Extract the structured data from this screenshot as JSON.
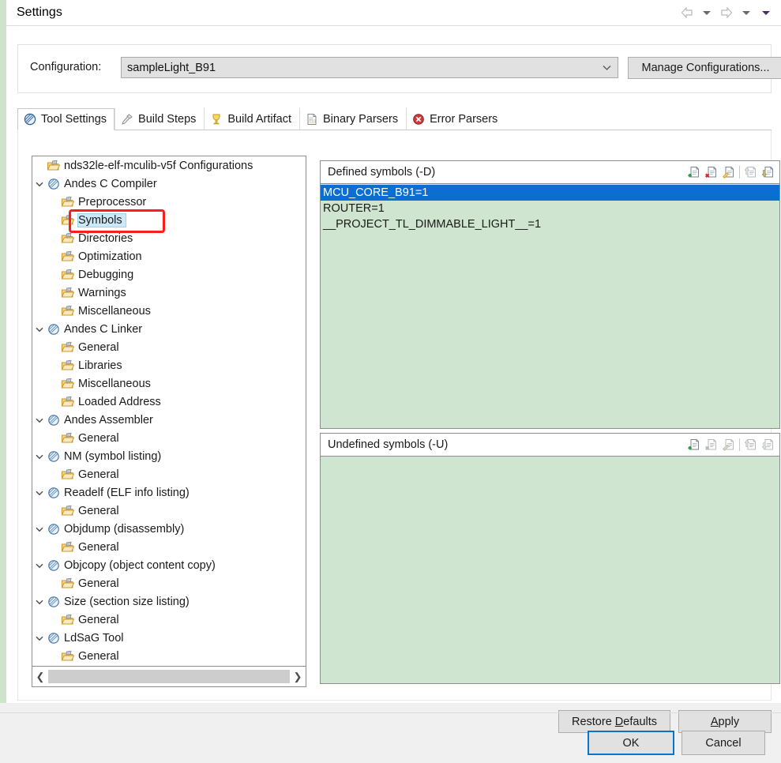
{
  "window": {
    "title": "Settings",
    "nav": {
      "back_icon": "arrow-left-icon",
      "back_dropdown_icon": "chevron-down-icon",
      "forward_icon": "arrow-right-icon",
      "forward_dropdown_icon": "chevron-down-icon",
      "menu_dropdown_icon": "chevron-down-icon"
    }
  },
  "configuration": {
    "label": "Configuration:",
    "value": "sampleLight_B91",
    "dropdown_icon": "chevron-down-icon",
    "manage_button": "Manage Configurations..."
  },
  "tabs": [
    {
      "label": "Tool Settings",
      "icon": "tool-settings-icon",
      "active": true
    },
    {
      "label": "Build Steps",
      "icon": "build-steps-icon",
      "active": false
    },
    {
      "label": "Build Artifact",
      "icon": "build-artifact-icon",
      "active": false
    },
    {
      "label": "Binary Parsers",
      "icon": "binary-parsers-icon",
      "active": false
    },
    {
      "label": "Error Parsers",
      "icon": "error-parsers-icon",
      "active": false
    }
  ],
  "tree": {
    "items": [
      {
        "label": "nds32le-elf-mculib-v5f Configurations",
        "indent": 0,
        "icon": "folder-icon",
        "twisty": "none",
        "selected": false
      },
      {
        "label": "Andes C Compiler",
        "indent": 0,
        "icon": "tool-icon",
        "twisty": "expanded",
        "selected": false
      },
      {
        "label": "Preprocessor",
        "indent": 1,
        "icon": "folder-icon",
        "twisty": "none",
        "selected": false
      },
      {
        "label": "Symbols",
        "indent": 1,
        "icon": "folder-icon",
        "twisty": "none",
        "selected": true
      },
      {
        "label": "Directories",
        "indent": 1,
        "icon": "folder-icon",
        "twisty": "none",
        "selected": false
      },
      {
        "label": "Optimization",
        "indent": 1,
        "icon": "folder-icon",
        "twisty": "none",
        "selected": false
      },
      {
        "label": "Debugging",
        "indent": 1,
        "icon": "folder-icon",
        "twisty": "none",
        "selected": false
      },
      {
        "label": "Warnings",
        "indent": 1,
        "icon": "folder-icon",
        "twisty": "none",
        "selected": false
      },
      {
        "label": "Miscellaneous",
        "indent": 1,
        "icon": "folder-icon",
        "twisty": "none",
        "selected": false
      },
      {
        "label": "Andes C Linker",
        "indent": 0,
        "icon": "tool-icon",
        "twisty": "expanded",
        "selected": false
      },
      {
        "label": "General",
        "indent": 1,
        "icon": "folder-icon",
        "twisty": "none",
        "selected": false
      },
      {
        "label": "Libraries",
        "indent": 1,
        "icon": "folder-icon",
        "twisty": "none",
        "selected": false
      },
      {
        "label": "Miscellaneous",
        "indent": 1,
        "icon": "folder-icon",
        "twisty": "none",
        "selected": false
      },
      {
        "label": "Loaded Address",
        "indent": 1,
        "icon": "folder-icon",
        "twisty": "none",
        "selected": false
      },
      {
        "label": "Andes Assembler",
        "indent": 0,
        "icon": "tool-icon",
        "twisty": "expanded",
        "selected": false
      },
      {
        "label": "General",
        "indent": 1,
        "icon": "folder-icon",
        "twisty": "none",
        "selected": false
      },
      {
        "label": "NM (symbol listing)",
        "indent": 0,
        "icon": "tool-icon",
        "twisty": "expanded",
        "selected": false
      },
      {
        "label": "General",
        "indent": 1,
        "icon": "folder-icon",
        "twisty": "none",
        "selected": false
      },
      {
        "label": "Readelf (ELF info listing)",
        "indent": 0,
        "icon": "tool-icon",
        "twisty": "expanded",
        "selected": false
      },
      {
        "label": "General",
        "indent": 1,
        "icon": "folder-icon",
        "twisty": "none",
        "selected": false
      },
      {
        "label": "Objdump (disassembly)",
        "indent": 0,
        "icon": "tool-icon",
        "twisty": "expanded",
        "selected": false
      },
      {
        "label": "General",
        "indent": 1,
        "icon": "folder-icon",
        "twisty": "none",
        "selected": false
      },
      {
        "label": "Objcopy (object content copy)",
        "indent": 0,
        "icon": "tool-icon",
        "twisty": "expanded",
        "selected": false
      },
      {
        "label": "General",
        "indent": 1,
        "icon": "folder-icon",
        "twisty": "none",
        "selected": false
      },
      {
        "label": "Size (section size listing)",
        "indent": 0,
        "icon": "tool-icon",
        "twisty": "expanded",
        "selected": false
      },
      {
        "label": "General",
        "indent": 1,
        "icon": "folder-icon",
        "twisty": "none",
        "selected": false
      },
      {
        "label": "LdSaG Tool",
        "indent": 0,
        "icon": "tool-icon",
        "twisty": "expanded",
        "selected": false
      },
      {
        "label": "General",
        "indent": 1,
        "icon": "folder-icon",
        "twisty": "none",
        "selected": false
      }
    ],
    "scroll_left_icon": "chevron-left-icon",
    "scroll_right_icon": "chevron-right-icon"
  },
  "defined_symbols": {
    "title": "Defined symbols (-D)",
    "tools": [
      {
        "name": "add-icon",
        "enabled": true
      },
      {
        "name": "delete-icon",
        "enabled": true
      },
      {
        "name": "edit-icon",
        "enabled": true
      },
      {
        "name": "move-up-icon",
        "enabled": false
      },
      {
        "name": "move-down-icon",
        "enabled": true
      }
    ],
    "items": [
      {
        "text": "MCU_CORE_B91=1",
        "selected": true
      },
      {
        "text": "ROUTER=1",
        "selected": false
      },
      {
        "text": "__PROJECT_TL_DIMMABLE_LIGHT__=1",
        "selected": false
      }
    ]
  },
  "undefined_symbols": {
    "title": "Undefined symbols (-U)",
    "tools": [
      {
        "name": "add-icon",
        "enabled": true
      },
      {
        "name": "delete-icon",
        "enabled": false
      },
      {
        "name": "edit-icon",
        "enabled": false
      },
      {
        "name": "move-up-icon",
        "enabled": false
      },
      {
        "name": "move-down-icon",
        "enabled": false
      }
    ],
    "items": []
  },
  "buttons": {
    "restore_defaults": "Restore Defaults",
    "restore_defaults_mnemonic": "D",
    "apply": "Apply",
    "apply_mnemonic": "A",
    "ok": "OK",
    "cancel": "Cancel"
  },
  "colors": {
    "list_background": "#cfe5cf",
    "selection_blue": "#0a6fd1",
    "tree_selection": "#cde8f6",
    "annotation_red": "#fc1d1d",
    "default_button_border": "#0a74c8"
  }
}
